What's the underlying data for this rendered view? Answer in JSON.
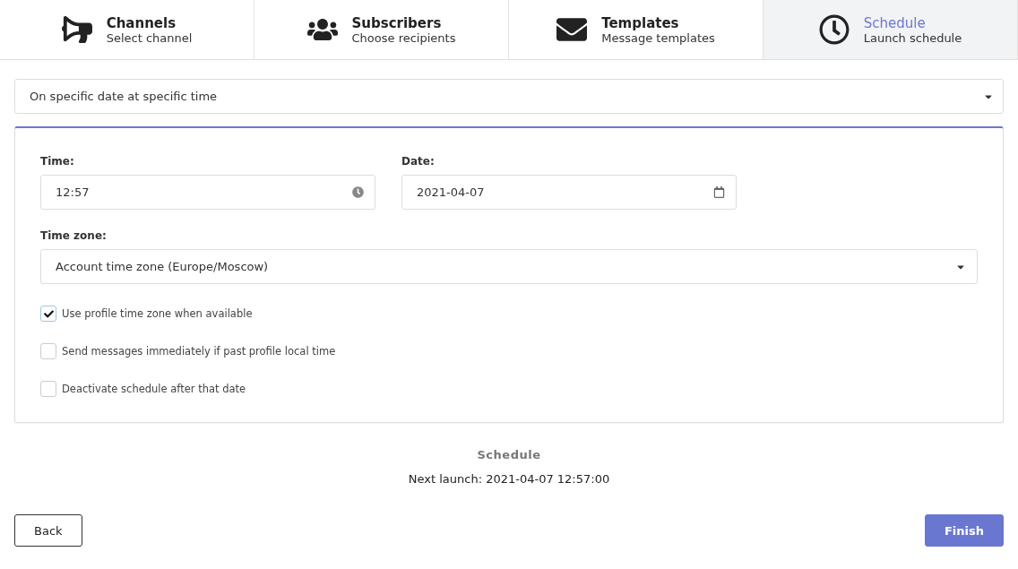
{
  "steps": [
    {
      "kind": "megaphone",
      "title": "Channels",
      "subtitle": "Select channel",
      "selected": false
    },
    {
      "kind": "users",
      "title": "Subscribers",
      "subtitle": "Choose recipients",
      "selected": false
    },
    {
      "kind": "envelope",
      "title": "Templates",
      "subtitle": "Message templates",
      "selected": false
    },
    {
      "kind": "clock",
      "title": "Schedule",
      "subtitle": "Launch schedule",
      "selected": true
    }
  ],
  "schedule_type": {
    "value": "On specific date at specific time"
  },
  "time": {
    "label": "Time:",
    "value": "12:57"
  },
  "date": {
    "label": "Date:",
    "value": "2021-04-07"
  },
  "time_zone": {
    "label": "Time zone:",
    "value": "Account time zone (Europe/Moscow)"
  },
  "options": [
    {
      "label": "Use profile time zone when available",
      "checked": true
    },
    {
      "label": "Send messages immediately if past profile local time",
      "checked": false
    },
    {
      "label": "Deactivate schedule after that date",
      "checked": false
    }
  ],
  "summary": {
    "title": "Schedule",
    "text": "Next launch: 2021-04-07 12:57:00"
  },
  "buttons": {
    "back": "Back",
    "finish": "Finish"
  }
}
